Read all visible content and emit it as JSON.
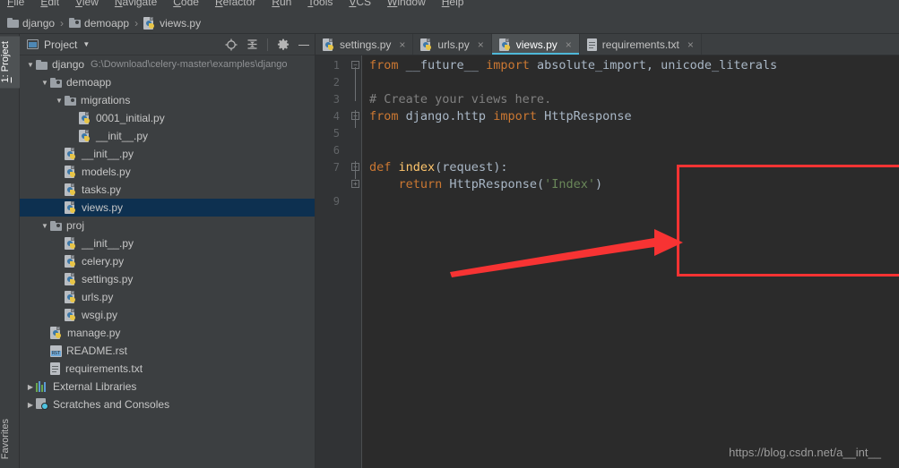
{
  "menubar": {
    "items": [
      "File",
      "Edit",
      "View",
      "Navigate",
      "Code",
      "Refactor",
      "Run",
      "Tools",
      "VCS",
      "Window",
      "Help"
    ]
  },
  "breadcrumb": {
    "items": [
      {
        "label": "django",
        "icon": "folder-icon"
      },
      {
        "label": "demoapp",
        "icon": "folder-source-icon"
      },
      {
        "label": "views.py",
        "icon": "python-file-icon"
      }
    ],
    "separator": "›"
  },
  "leftstrip": {
    "project_button": "1: Project",
    "project_number": "1",
    "project_label": ": Project",
    "favorites_button": "Favorites"
  },
  "project_panel": {
    "title": "Project",
    "caret": "▼",
    "toolbar": [
      {
        "name": "select-opened-file-icon",
        "label": "Select Opened File"
      },
      {
        "name": "collapse-all-icon",
        "label": "Collapse All"
      },
      {
        "name": "gear-icon",
        "label": "Settings"
      },
      {
        "name": "minimize-icon",
        "label": "Hide"
      }
    ],
    "tree": [
      {
        "depth": 0,
        "arrow": "▼",
        "icon": "folder-icon",
        "label": "django",
        "path": "G:\\Download\\celery-master\\examples\\django",
        "selected": false
      },
      {
        "depth": 1,
        "arrow": "▼",
        "icon": "folder-source-icon",
        "label": "demoapp",
        "path": "",
        "selected": false
      },
      {
        "depth": 2,
        "arrow": "▼",
        "icon": "folder-source-icon",
        "label": "migrations",
        "path": "",
        "selected": false
      },
      {
        "depth": 3,
        "arrow": "",
        "icon": "python-file-icon",
        "label": "0001_initial.py",
        "path": "",
        "selected": false
      },
      {
        "depth": 3,
        "arrow": "",
        "icon": "python-file-icon",
        "label": "__init__.py",
        "path": "",
        "selected": false
      },
      {
        "depth": 2,
        "arrow": "",
        "icon": "python-file-icon",
        "label": "__init__.py",
        "path": "",
        "selected": false
      },
      {
        "depth": 2,
        "arrow": "",
        "icon": "python-file-icon",
        "label": "models.py",
        "path": "",
        "selected": false
      },
      {
        "depth": 2,
        "arrow": "",
        "icon": "python-file-icon",
        "label": "tasks.py",
        "path": "",
        "selected": false
      },
      {
        "depth": 2,
        "arrow": "",
        "icon": "python-file-icon",
        "label": "views.py",
        "path": "",
        "selected": true
      },
      {
        "depth": 1,
        "arrow": "▼",
        "icon": "folder-source-icon",
        "label": "proj",
        "path": "",
        "selected": false
      },
      {
        "depth": 2,
        "arrow": "",
        "icon": "python-file-icon",
        "label": "__init__.py",
        "path": "",
        "selected": false
      },
      {
        "depth": 2,
        "arrow": "",
        "icon": "python-file-icon",
        "label": "celery.py",
        "path": "",
        "selected": false
      },
      {
        "depth": 2,
        "arrow": "",
        "icon": "python-file-icon",
        "label": "settings.py",
        "path": "",
        "selected": false
      },
      {
        "depth": 2,
        "arrow": "",
        "icon": "python-file-icon",
        "label": "urls.py",
        "path": "",
        "selected": false
      },
      {
        "depth": 2,
        "arrow": "",
        "icon": "python-file-icon",
        "label": "wsgi.py",
        "path": "",
        "selected": false
      },
      {
        "depth": 1,
        "arrow": "",
        "icon": "python-file-icon",
        "label": "manage.py",
        "path": "",
        "selected": false
      },
      {
        "depth": 1,
        "arrow": "",
        "icon": "rst-file-icon",
        "label": "README.rst",
        "path": "",
        "selected": false
      },
      {
        "depth": 1,
        "arrow": "",
        "icon": "txt-file-icon",
        "label": "requirements.txt",
        "path": "",
        "selected": false
      },
      {
        "depth": 0,
        "arrow": "▶",
        "icon": "external-libraries-icon",
        "label": "External Libraries",
        "path": "",
        "selected": false
      },
      {
        "depth": 0,
        "arrow": "▶",
        "icon": "scratches-icon",
        "label": "Scratches and Consoles",
        "path": "",
        "selected": false
      }
    ]
  },
  "editor": {
    "tabs": [
      {
        "label": "settings.py",
        "icon": "python-file-icon",
        "active": false,
        "close": "×"
      },
      {
        "label": "urls.py",
        "icon": "python-file-icon",
        "active": false,
        "close": "×"
      },
      {
        "label": "views.py",
        "icon": "python-file-icon",
        "active": true,
        "close": "×"
      },
      {
        "label": "requirements.txt",
        "icon": "txt-file-icon",
        "active": false,
        "close": "×"
      }
    ],
    "line_numbers": [
      "1",
      "2",
      "3",
      "4",
      "5",
      "6",
      "7",
      "",
      "9"
    ],
    "code_lines": [
      [
        {
          "t": "from",
          "c": "kw"
        },
        {
          "t": " __future__ ",
          "c": "id"
        },
        {
          "t": "import",
          "c": "kw"
        },
        {
          "t": " absolute_import, unicode_literals",
          "c": "id"
        }
      ],
      [],
      [
        {
          "t": "# Create your views here.",
          "c": "cm"
        }
      ],
      [
        {
          "t": "from",
          "c": "kw"
        },
        {
          "t": " django.http ",
          "c": "id"
        },
        {
          "t": "import",
          "c": "kw"
        },
        {
          "t": " HttpResponse",
          "c": "id"
        }
      ],
      [],
      [],
      [
        {
          "t": "def",
          "c": "kw"
        },
        {
          "t": " ",
          "c": "id"
        },
        {
          "t": "index",
          "c": "fn"
        },
        {
          "t": "(request):",
          "c": "id"
        }
      ],
      [
        {
          "t": "    ",
          "c": "id"
        },
        {
          "t": "return",
          "c": "kw"
        },
        {
          "t": " HttpResponse(",
          "c": "id"
        },
        {
          "t": "'Index'",
          "c": "str"
        },
        {
          "t": ")",
          "c": "id"
        }
      ],
      []
    ]
  },
  "annotations": {
    "box_color": "#f73333",
    "arrow_color": "#f73333"
  },
  "watermark": "https://blog.csdn.net/a__int__"
}
